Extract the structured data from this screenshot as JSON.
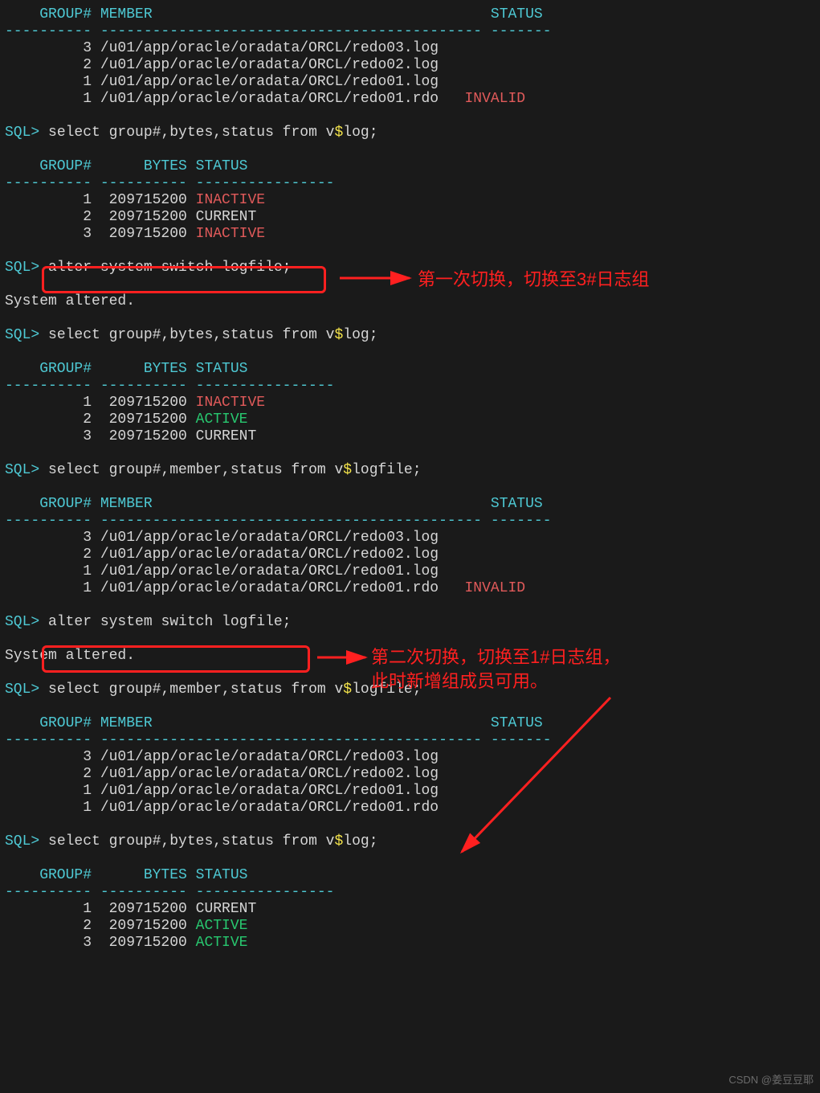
{
  "colors": {
    "cyan": "#4ec9d4",
    "yellow": "#f2e24a",
    "red": "#e05a5a",
    "green": "#28c76f",
    "bg": "#1a1a1a",
    "fg": "#d6d6d6",
    "highlight": "#ff2020"
  },
  "header1": {
    "cols": "    GROUP# MEMBER                                       STATUS",
    "dash": "---------- -------------------------------------------- -------"
  },
  "logfiles1": [
    {
      "group": "         3",
      "member": " /u01/app/oracle/oradata/ORCL/redo03.log",
      "status": ""
    },
    {
      "group": "         2",
      "member": " /u01/app/oracle/oradata/ORCL/redo02.log",
      "status": ""
    },
    {
      "group": "         1",
      "member": " /u01/app/oracle/oradata/ORCL/redo01.log",
      "status": ""
    },
    {
      "group": "         1",
      "member": " /u01/app/oracle/oradata/ORCL/redo01.rdo",
      "status": "   INVALID",
      "invalid": true
    }
  ],
  "prompt": "SQL>",
  "q_log": {
    "pre": " select group#,bytes,status from v",
    "dollar": "$",
    "post": "log;"
  },
  "q_logfile": {
    "pre": " select group#,member,status from v",
    "dollar": "$",
    "post": "logfile;"
  },
  "log_hdr": {
    "cols": "    GROUP#      BYTES STATUS",
    "dash": "---------- ---------- ----------------"
  },
  "log1": [
    {
      "g": "         1",
      "b": "  209715200 ",
      "s": "INACTIVE",
      "inactive": true
    },
    {
      "g": "         2",
      "b": "  209715200 ",
      "s": "CURRENT"
    },
    {
      "g": "         3",
      "b": "  209715200 ",
      "s": "INACTIVE",
      "inactive": true
    }
  ],
  "alter": " alter system switch logfile;",
  "altered": "System altered.",
  "log2": [
    {
      "g": "         1",
      "b": "  209715200 ",
      "s": "INACTIVE",
      "inactive": true
    },
    {
      "g": "         2",
      "b": "  209715200 ",
      "s": "ACTIVE",
      "active": true
    },
    {
      "g": "         3",
      "b": "  209715200 ",
      "s": "CURRENT"
    }
  ],
  "logfiles2": [
    {
      "group": "         3",
      "member": " /u01/app/oracle/oradata/ORCL/redo03.log",
      "status": ""
    },
    {
      "group": "         2",
      "member": " /u01/app/oracle/oradata/ORCL/redo02.log",
      "status": ""
    },
    {
      "group": "         1",
      "member": " /u01/app/oracle/oradata/ORCL/redo01.log",
      "status": ""
    },
    {
      "group": "         1",
      "member": " /u01/app/oracle/oradata/ORCL/redo01.rdo",
      "status": "   INVALID",
      "invalid": true
    }
  ],
  "logfiles3": [
    {
      "group": "         3",
      "member": " /u01/app/oracle/oradata/ORCL/redo03.log",
      "status": ""
    },
    {
      "group": "         2",
      "member": " /u01/app/oracle/oradata/ORCL/redo02.log",
      "status": ""
    },
    {
      "group": "         1",
      "member": " /u01/app/oracle/oradata/ORCL/redo01.log",
      "status": ""
    },
    {
      "group": "         1",
      "member": " /u01/app/oracle/oradata/ORCL/redo01.rdo",
      "status": ""
    }
  ],
  "log3": [
    {
      "g": "         1",
      "b": "  209715200 ",
      "s": "CURRENT"
    },
    {
      "g": "         2",
      "b": "  209715200 ",
      "s": "ACTIVE",
      "active": true
    },
    {
      "g": "         3",
      "b": "  209715200 ",
      "s": "ACTIVE",
      "active": true
    }
  ],
  "annot1": "第一次切换，切换至3#日志组",
  "annot2a": "第二次切换，切换至1#日志组，",
  "annot2b": "此时新增组成员可用。",
  "watermark": "CSDN @姜豆豆耶"
}
